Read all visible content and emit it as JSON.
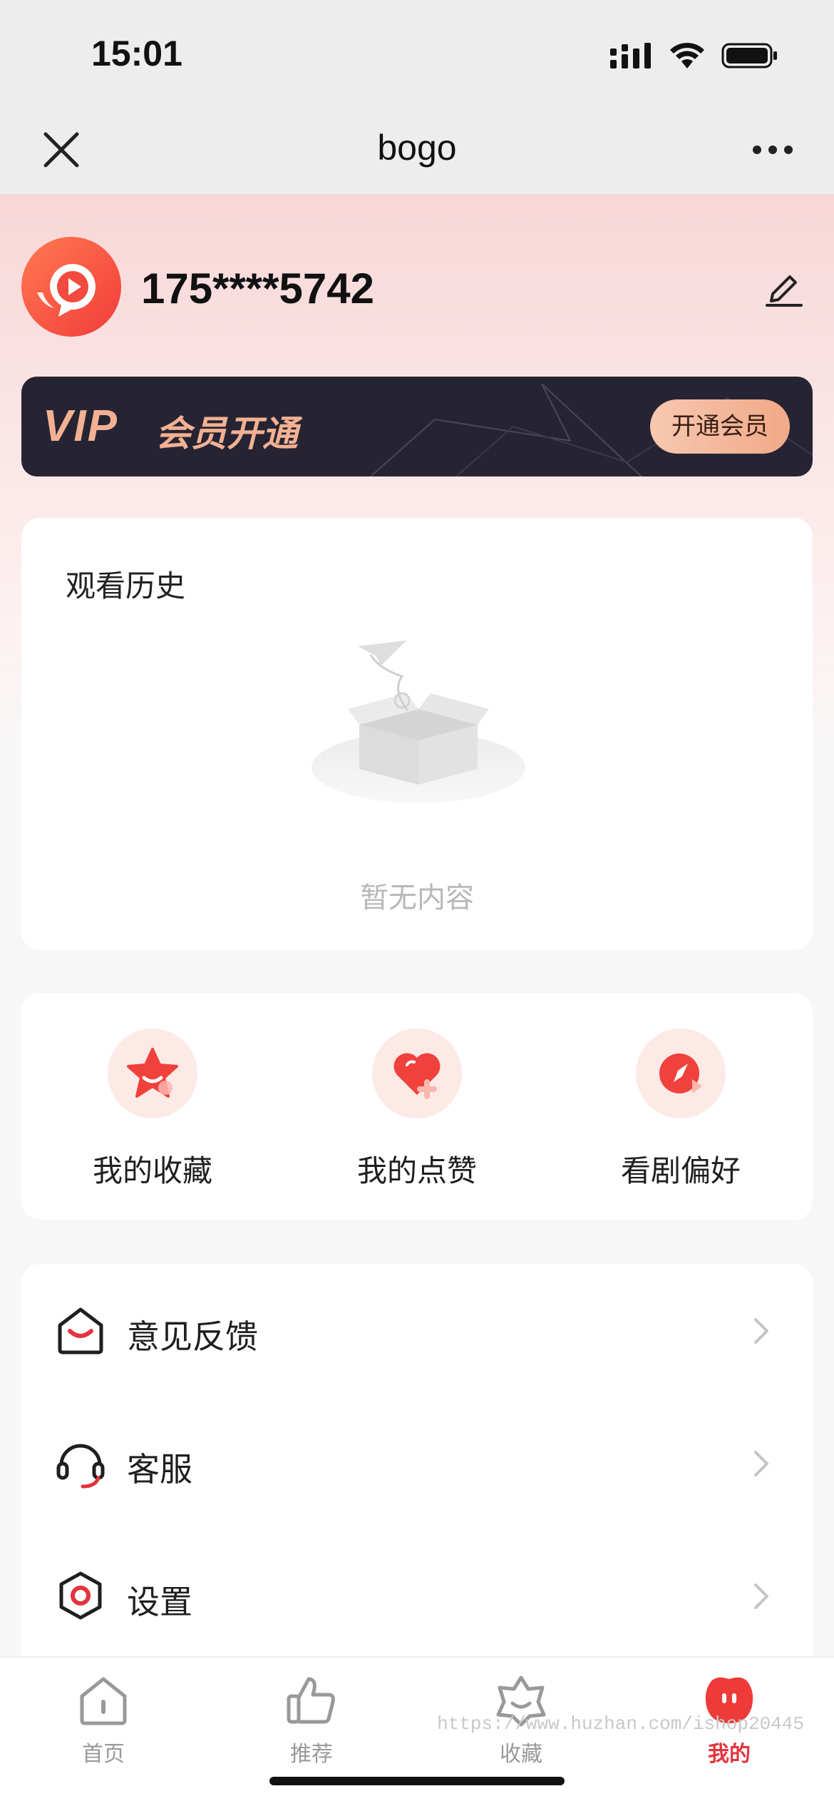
{
  "status_bar": {
    "time": "15:01"
  },
  "nav": {
    "title": "bogo",
    "close_icon": "close-icon",
    "more_icon": "more-icon"
  },
  "profile": {
    "username": "175****5742"
  },
  "vip": {
    "logo": "VIP",
    "title": "会员开通",
    "button": "开通会员"
  },
  "history": {
    "title": "观看历史",
    "empty_text": "暂无内容"
  },
  "quick_actions": [
    {
      "label": "我的收藏",
      "icon": "star-icon"
    },
    {
      "label": "我的点赞",
      "icon": "heart-icon"
    },
    {
      "label": "看剧偏好",
      "icon": "compass-icon"
    }
  ],
  "menu": [
    {
      "label": "意见反馈",
      "icon": "feedback-mail-icon"
    },
    {
      "label": "客服",
      "icon": "headset-icon"
    },
    {
      "label": "设置",
      "icon": "settings-icon"
    }
  ],
  "tabs": [
    {
      "label": "首页",
      "icon": "home-icon",
      "active": false
    },
    {
      "label": "推荐",
      "icon": "thumbs-up-icon",
      "active": false
    },
    {
      "label": "收藏",
      "icon": "favorite-icon",
      "active": false
    },
    {
      "label": "我的",
      "icon": "profile-icon",
      "active": true
    }
  ],
  "watermark": "https://www.huzhan.com/ishop20445",
  "colors": {
    "accent": "#e4343d",
    "vip_bg": "#262433",
    "vip_gold": "#f3b193"
  }
}
